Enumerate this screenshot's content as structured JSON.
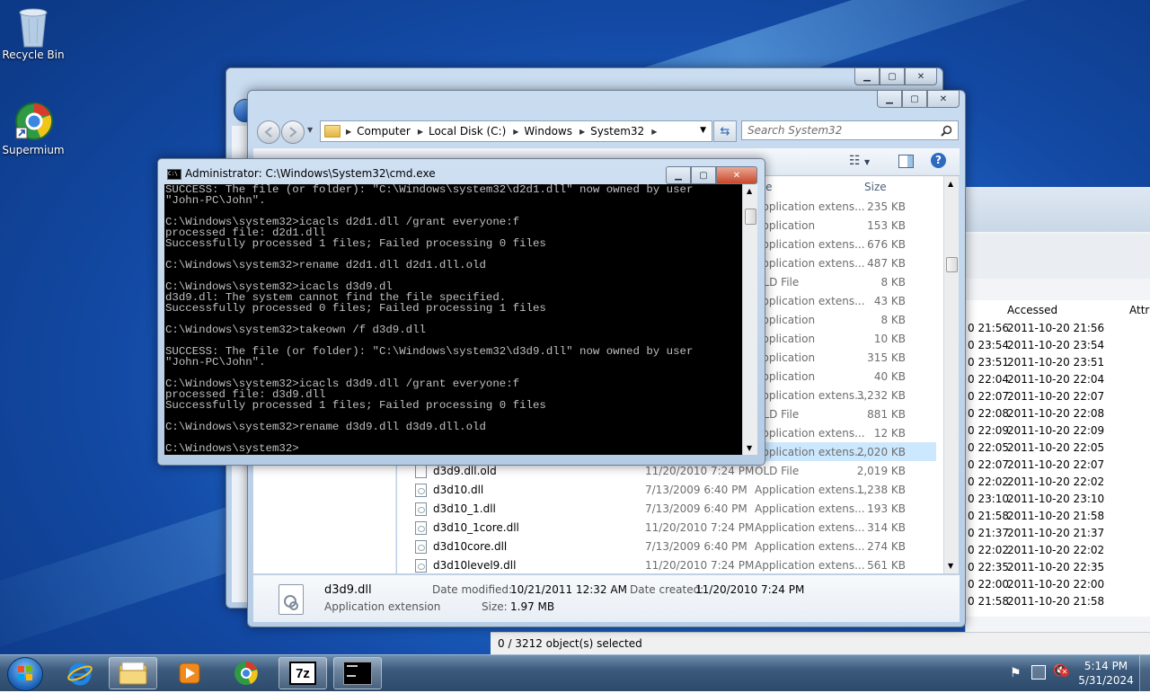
{
  "desktop": {
    "icons": [
      {
        "label": "Recycle Bin",
        "icon": "recycle-bin-icon"
      },
      {
        "label": "Supermium",
        "icon": "supermium-browser-icon"
      }
    ]
  },
  "explorer": {
    "breadcrumb": [
      "Computer",
      "Local Disk (C:)",
      "Windows",
      "System32"
    ],
    "search_placeholder": "Search System32",
    "columns": {
      "type": "Type",
      "size": "Size"
    },
    "files_partial": [
      {
        "type": "Application extens...",
        "size": "235 KB"
      },
      {
        "type": "Application",
        "size": "153 KB"
      },
      {
        "type": "Application extens...",
        "size": "676 KB"
      },
      {
        "type": "Application extens...",
        "size": "487 KB"
      },
      {
        "type": "OLD File",
        "size": "8 KB"
      },
      {
        "type": "Application extens...",
        "size": "43 KB"
      },
      {
        "type": "Application",
        "size": "8 KB"
      },
      {
        "type": "Application",
        "size": "10 KB"
      },
      {
        "type": "Application",
        "size": "315 KB"
      },
      {
        "type": "Application",
        "size": "40 KB"
      },
      {
        "type": "Application extens...",
        "size": "3,232 KB"
      },
      {
        "type": "OLD File",
        "size": "881 KB"
      },
      {
        "type": "Application extens...",
        "size": "12 KB"
      },
      {
        "type": "Application extens...",
        "size": "2,020 KB"
      }
    ],
    "files": [
      {
        "name": "d3d9.dll.old",
        "date": "11/20/2010 7:24 PM",
        "type": "OLD File",
        "size": "2,019 KB",
        "icon": "blank-file-icon"
      },
      {
        "name": "d3d10.dll",
        "date": "7/13/2009 6:40 PM",
        "type": "Application extens...",
        "size": "1,238 KB",
        "icon": "dll-file-icon"
      },
      {
        "name": "d3d10_1.dll",
        "date": "7/13/2009 6:40 PM",
        "type": "Application extens...",
        "size": "193 KB",
        "icon": "dll-file-icon"
      },
      {
        "name": "d3d10_1core.dll",
        "date": "11/20/2010 7:24 PM",
        "type": "Application extens...",
        "size": "314 KB",
        "icon": "dll-file-icon"
      },
      {
        "name": "d3d10core.dll",
        "date": "7/13/2009 6:40 PM",
        "type": "Application extens...",
        "size": "274 KB",
        "icon": "dll-file-icon"
      },
      {
        "name": "d3d10level9.dll",
        "date": "11/20/2010 7:24 PM",
        "type": "Application extens...",
        "size": "561 KB",
        "icon": "dll-file-icon"
      }
    ],
    "details": {
      "name": "d3d9.dll",
      "kind": "Application extension",
      "date_modified_label": "Date modified:",
      "date_modified": "10/21/2011 12:32 AM",
      "date_created_label": "Date created:",
      "date_created": "11/20/2010 7:24 PM",
      "size_label": "Size:",
      "size": "1.97 MB"
    }
  },
  "back_window": {
    "accessed_header": "Accessed",
    "attri_header": "Attri",
    "rows": [
      {
        "left": "0 21:56",
        "accessed": "2011-10-20 21:56"
      },
      {
        "left": "0 23:54",
        "accessed": "2011-10-20 23:54"
      },
      {
        "left": "0 23:51",
        "accessed": "2011-10-20 23:51"
      },
      {
        "left": "0 22:04",
        "accessed": "2011-10-20 22:04"
      },
      {
        "left": "0 22:07",
        "accessed": "2011-10-20 22:07"
      },
      {
        "left": "0 22:08",
        "accessed": "2011-10-20 22:08"
      },
      {
        "left": "0 22:09",
        "accessed": "2011-10-20 22:09"
      },
      {
        "left": "0 22:05",
        "accessed": "2011-10-20 22:05"
      },
      {
        "left": "0 22:07",
        "accessed": "2011-10-20 22:07"
      },
      {
        "left": "0 22:02",
        "accessed": "2011-10-20 22:02"
      },
      {
        "left": "0 23:10",
        "accessed": "2011-10-20 23:10"
      },
      {
        "left": "0 21:58",
        "accessed": "2011-10-20 21:58"
      },
      {
        "left": "0 21:37",
        "accessed": "2011-10-20 21:37"
      },
      {
        "left": "0 22:02",
        "accessed": "2011-10-20 22:02"
      },
      {
        "left": "0 22:35",
        "accessed": "2011-10-20 22:35"
      },
      {
        "left": "0 22:00",
        "accessed": "2011-10-20 22:00"
      },
      {
        "left": "0 21:58",
        "accessed": "2011-10-20 21:58"
      }
    ],
    "status": "0 / 3212 object(s) selected"
  },
  "cmd": {
    "title": "Administrator: C:\\Windows\\System32\\cmd.exe",
    "lines": [
      "SUCCESS: The file (or folder): \"C:\\Windows\\system32\\d2d1.dll\" now owned by user",
      "\"John-PC\\John\".",
      "",
      "C:\\Windows\\system32>icacls d2d1.dll /grant everyone:f",
      "processed file: d2d1.dll",
      "Successfully processed 1 files; Failed processing 0 files",
      "",
      "C:\\Windows\\system32>rename d2d1.dll d2d1.dll.old",
      "",
      "C:\\Windows\\system32>icacls d3d9.dl",
      "d3d9.dl: The system cannot find the file specified.",
      "Successfully processed 0 files; Failed processing 1 files",
      "",
      "C:\\Windows\\system32>takeown /f d3d9.dll",
      "",
      "SUCCESS: The file (or folder): \"C:\\Windows\\system32\\d3d9.dll\" now owned by user",
      "\"John-PC\\John\".",
      "",
      "C:\\Windows\\system32>icacls d3d9.dll /grant everyone:f",
      "processed file: d3d9.dll",
      "Successfully processed 1 files; Failed processing 0 files",
      "",
      "C:\\Windows\\system32>rename d3d9.dll d3d9.dll.old",
      "",
      "C:\\Windows\\system32>"
    ]
  },
  "taskbar": {
    "buttons": [
      {
        "name": "start-button",
        "icon": "windows-start-icon"
      },
      {
        "name": "internet-explorer-button",
        "icon": "internet-explorer-icon"
      },
      {
        "name": "explorer-button",
        "icon": "folder-icon"
      },
      {
        "name": "media-player-button",
        "icon": "media-player-icon"
      },
      {
        "name": "supermium-button",
        "icon": "supermium-browser-icon"
      },
      {
        "name": "7zip-button",
        "icon": "7zip-icon",
        "label": "7z"
      },
      {
        "name": "cmd-button",
        "icon": "cmd-icon"
      }
    ],
    "tray": [
      "flag-icon",
      "network-icon",
      "volume-muted-icon"
    ],
    "clock_time": "5:14 PM",
    "clock_date": "5/31/2024"
  },
  "colors": {
    "accent": "#1f67c9",
    "cmd_bg": "#000000",
    "cmd_fg": "#c0c0c0",
    "selection": "#cce8ff"
  }
}
